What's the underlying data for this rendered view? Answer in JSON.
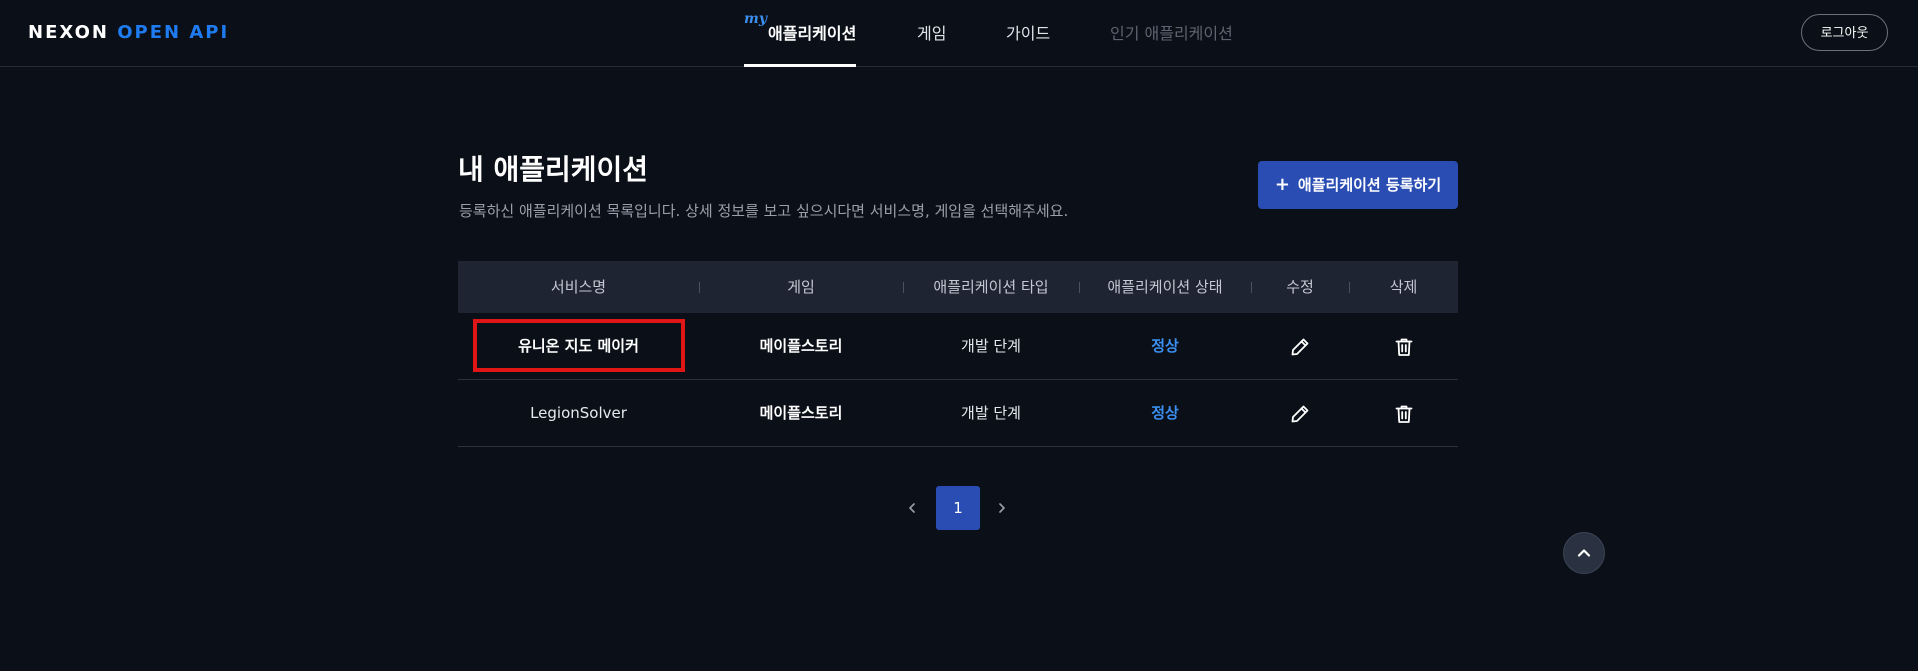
{
  "header": {
    "logo_part1": "NEXON",
    "logo_part2": "OPEN API",
    "nav": {
      "my_tag": "my",
      "items": [
        {
          "label": "애플리케이션"
        },
        {
          "label": "게임"
        },
        {
          "label": "가이드"
        },
        {
          "label": "인기 애플리케이션"
        }
      ],
      "active_index": 0
    },
    "logout_label": "로그아웃"
  },
  "main": {
    "title": "내 애플리케이션",
    "description": "등록하신 애플리케이션 목록입니다. 상세 정보를 보고 싶으시다면 서비스명, 게임을 선택해주세요.",
    "register_button": {
      "icon": "plus-icon",
      "label": "애플리케이션 등록하기"
    }
  },
  "table": {
    "columns": [
      "서비스명",
      "게임",
      "애플리케이션 타입",
      "애플리케이션 상태",
      "수정",
      "삭제"
    ],
    "rows": [
      {
        "service": "유니온 지도 메이커",
        "game": "메이플스토리",
        "type": "개발 단계",
        "status": "정상",
        "edit_icon": "pencil-icon",
        "delete_icon": "trash-icon",
        "highlighted": true
      },
      {
        "service": "LegionSolver",
        "game": "메이플스토리",
        "type": "개발 단계",
        "status": "정상",
        "edit_icon": "pencil-icon",
        "delete_icon": "trash-icon",
        "highlighted": false
      }
    ]
  },
  "pagination": {
    "prev_icon": "chevron-left-icon",
    "current_page": "1",
    "next_icon": "chevron-right-icon"
  },
  "scroll_top": {
    "icon": "chevron-up-icon"
  },
  "colors": {
    "background": "#0b0f17",
    "accent_blue": "#2a4db3",
    "status_blue": "#3a8ff0",
    "highlight_red": "#e01515",
    "table_header": "#1f2433"
  }
}
